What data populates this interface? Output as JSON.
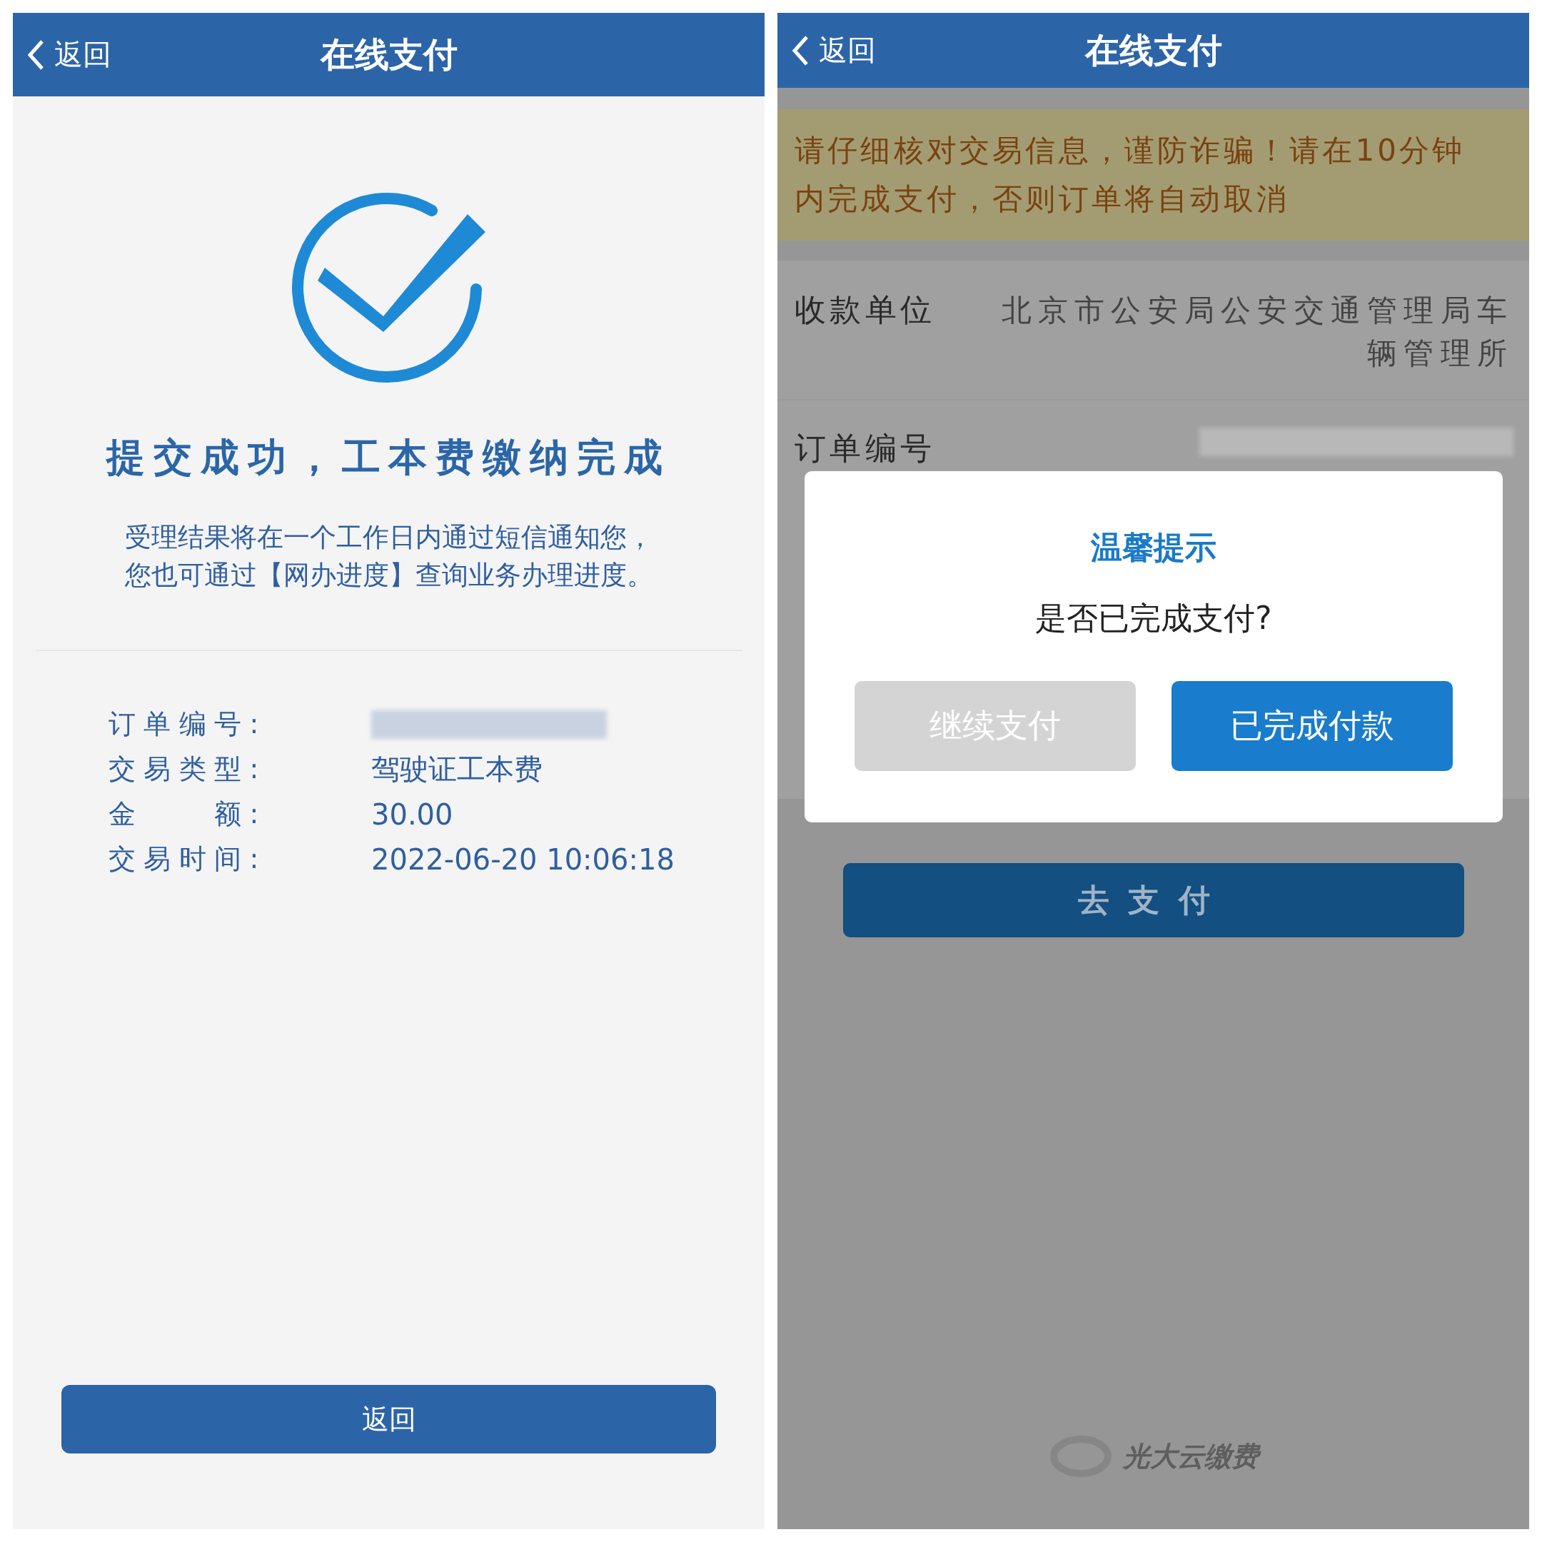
{
  "left_screen": {
    "header": {
      "back": "返回",
      "title": "在线支付"
    },
    "success_title": "提交成功，工本费缴纳完成",
    "message_lines": [
      "受理结果将在一个工作日内通过短信通知您，",
      "您也可通过【网办进度】查询业务办理进度。"
    ],
    "details": [
      {
        "label": "订单编号:",
        "kind": "blurred"
      },
      {
        "label": "交易类型:",
        "kind": "text",
        "value": "驾驶证工本费"
      },
      {
        "label": "金　　额:",
        "kind": "text",
        "value": "30.00"
      },
      {
        "label": "交易时间:",
        "kind": "text",
        "value": "2022-06-20 10:06:18"
      }
    ],
    "button": "返回"
  },
  "right_screen": {
    "header": {
      "back": "返回",
      "title": "在线支付"
    },
    "notice": "请仔细核对交易信息，谨防诈骗！请在10分钟内完成支付，否则订单将自动取消",
    "payee": {
      "label": "收款单位",
      "value": "北京市公安局公安交通管理局车辆管理所"
    },
    "order": {
      "label": "订单编号",
      "kind": "blurred"
    },
    "pay_button": "去支付",
    "footer_logo": "光大云缴费",
    "dialog": {
      "title": "温馨提示",
      "message": "是否已完成支付?",
      "buttons": [
        {
          "label": "继续支付",
          "kind": "secondary"
        },
        {
          "label": "已完成付款",
          "kind": "primary"
        }
      ]
    }
  }
}
